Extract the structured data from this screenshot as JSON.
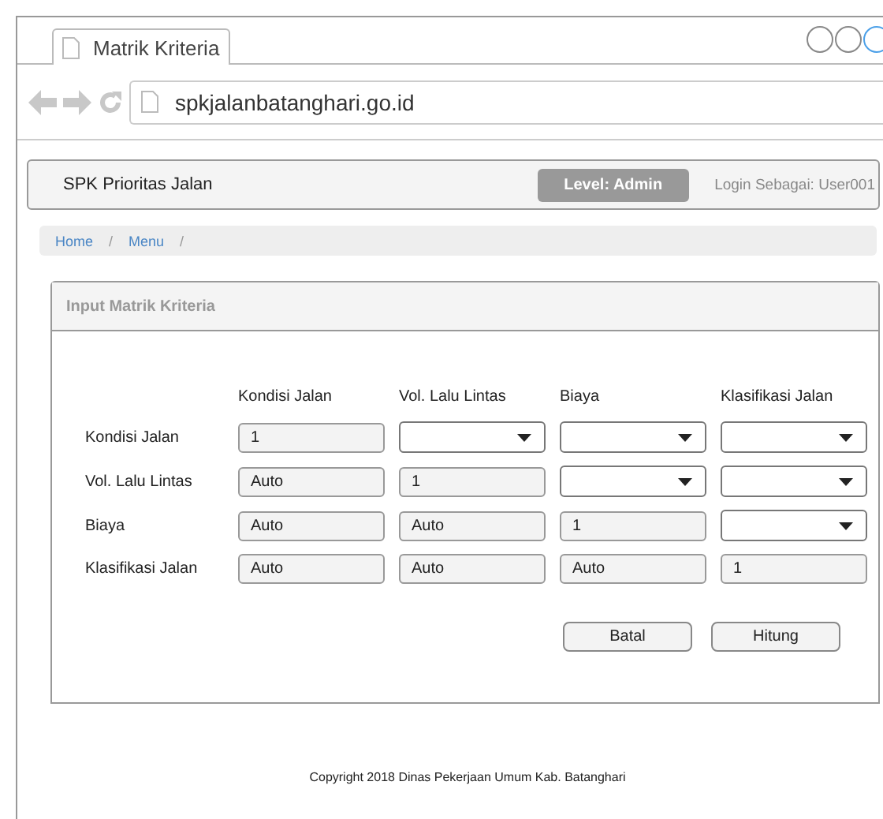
{
  "browser": {
    "tab_title": "Matrik Kriteria",
    "url": "spkjalanbatanghari.go.id"
  },
  "navbar": {
    "brand": "SPK Prioritas Jalan",
    "level_badge": "Level: Admin",
    "login": "Login Sebagai: User001"
  },
  "breadcrumb": {
    "items": [
      "Home",
      "Menu"
    ],
    "separator": "/"
  },
  "panel": {
    "title": "Input Matrik Kriteria",
    "columns": [
      "Kondisi Jalan",
      "Vol. Lalu Lintas",
      "Biaya",
      "Klasifikasi Jalan"
    ],
    "rows": [
      {
        "label": "Kondisi Jalan",
        "cells": [
          {
            "kind": "input",
            "value": "1"
          },
          {
            "kind": "select"
          },
          {
            "kind": "select"
          },
          {
            "kind": "select"
          }
        ]
      },
      {
        "label": "Vol. Lalu Lintas",
        "cells": [
          {
            "kind": "input",
            "value": "Auto"
          },
          {
            "kind": "input",
            "value": "1"
          },
          {
            "kind": "select"
          },
          {
            "kind": "select"
          }
        ]
      },
      {
        "label": "Biaya",
        "cells": [
          {
            "kind": "input",
            "value": "Auto"
          },
          {
            "kind": "input",
            "value": "Auto"
          },
          {
            "kind": "input",
            "value": "1"
          },
          {
            "kind": "select"
          }
        ]
      },
      {
        "label": "Klasifikasi Jalan",
        "cells": [
          {
            "kind": "input",
            "value": "Auto"
          },
          {
            "kind": "input",
            "value": "Auto"
          },
          {
            "kind": "input",
            "value": "Auto"
          },
          {
            "kind": "input",
            "value": "1"
          }
        ]
      }
    ],
    "buttons": [
      "Batal",
      "Hitung"
    ]
  },
  "footer": "Copyright 2018  Dinas Pekerjaan Umum Kab. Batanghari"
}
